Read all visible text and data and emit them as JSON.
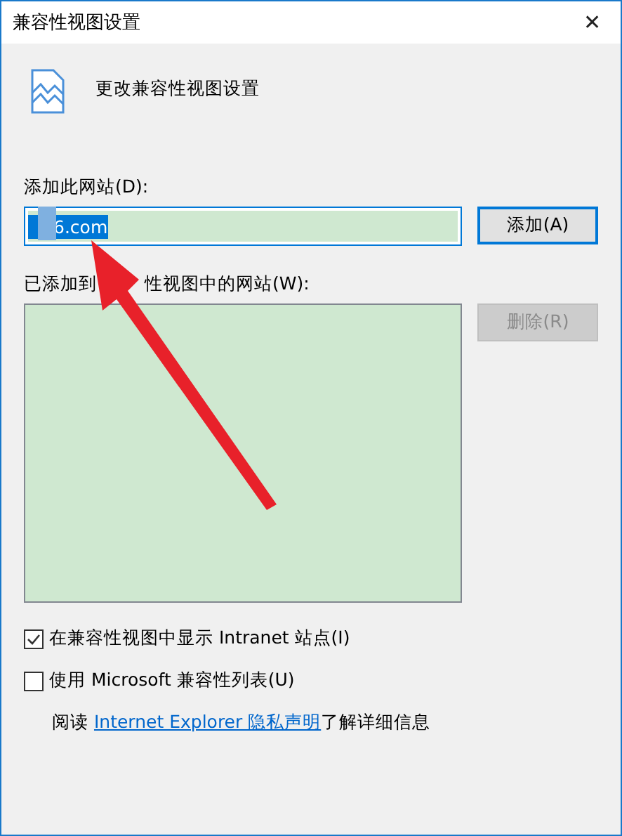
{
  "window": {
    "title": "兼容性视图设置",
    "close": "✕"
  },
  "heading": "更改兼容性视图设置",
  "add_site": {
    "label": "添加此网站(D):",
    "value": "6.com",
    "button": "添加(A)"
  },
  "added_sites": {
    "label_start": "已添加到",
    "label_end": "性视图中的网站(W):",
    "remove_button": {
      "label": "删除(R)",
      "disabled": true
    }
  },
  "options": [
    {
      "label": "在兼容性视图中显示 Intranet 站点(I)",
      "checked": true
    },
    {
      "label": "使用 Microsoft 兼容性列表(U)",
      "checked": false
    }
  ],
  "privacy": {
    "before": "阅读 ",
    "link": "Internet Explorer 隐私声明",
    "after": "了解详细信息"
  },
  "annotation": {
    "kind": "arrow"
  }
}
